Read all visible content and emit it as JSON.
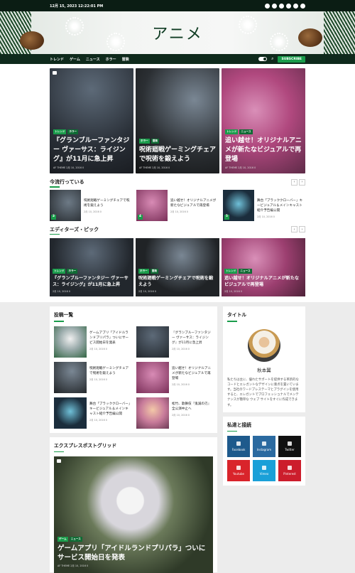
{
  "topbar": {
    "datetime": "12月 15, 2023 12:22:01 PM",
    "social_icons": [
      "facebook-icon",
      "instagram-icon",
      "twitter-icon",
      "youtube-icon",
      "vimeo-icon",
      "pinterest-icon"
    ]
  },
  "site": {
    "logo": "アニメ"
  },
  "nav": {
    "items": [
      "トレンド",
      "ゲーム",
      "ニュース",
      "ホラー",
      "冒険"
    ],
    "subscribe": "SUBSCRIBE"
  },
  "featured": [
    {
      "tags": [
        "トレンド",
        "ホラー"
      ],
      "title": "『グランブルーファンタジー ヴァーサス：ライジング』が11月に急上昇",
      "meta": "AF THEME  2月 10, 2016  0"
    },
    {
      "tags": [
        "ホラー",
        "冒険"
      ],
      "title": "呪術廻戦ゲーミングチェアで呪術を鍛えよう",
      "meta": "AF THEME  2月 10, 2016  0"
    },
    {
      "tags": [
        "トレンド",
        "ニュース"
      ],
      "title": "追い越せ！オリジナルアニメが新たなビジュアルで再登場",
      "meta": "AF THEME  2月 10, 2016  0"
    }
  ],
  "trending": {
    "heading": "今流行っている",
    "items": [
      {
        "num": "3",
        "title": "呪術廻戦ゲーミングチェアで呪術を鍛えよう",
        "meta": "2月 10, 2016  0"
      },
      {
        "num": "4",
        "title": "追い越せ！オリジナルアニメが新たなビジュアルで再登場",
        "meta": "2月 10, 2016  0"
      },
      {
        "num": "5",
        "title": "舞台「ブラッククローバー」キービジュアル＆メインキャスト紹介予告編公開",
        "meta": "2月 10, 2016  0"
      }
    ]
  },
  "editors": {
    "heading": "エディターズ・ピック",
    "items": [
      {
        "tags": [
          "トレンド",
          "ホラー"
        ],
        "title": "『グランブルーファンタジー ヴァーサス：ライジング』が11月に急上昇",
        "meta": "2月 10, 2016  0"
      },
      {
        "tags": [
          "ホラー",
          "冒険"
        ],
        "title": "呪術廻戦ゲーミングチェアで呪術を鍛えよう",
        "meta": "2月 10, 2016  0"
      },
      {
        "tags": [
          "トレンド",
          "ニュース"
        ],
        "title": "追い越せ！オリジナルアニメが新たなビジュアルで再登場",
        "meta": "2月 10, 2016  0"
      }
    ]
  },
  "posts": {
    "heading": "投稿一覧",
    "items": [
      {
        "title": "ゲームアプリ「アイドルランドプリパラ」ついにサービス開始日を発表",
        "meta": "2月 10, 2016  0"
      },
      {
        "title": "『グランブルーファンタジー ヴァーサス：ライジング』が11月に急上昇",
        "meta": "2月 10, 2016  0"
      },
      {
        "title": "呪術廻戦ゲーミングチェアで呪術を鍛えよう",
        "meta": "2月 10, 2016  0"
      },
      {
        "title": "追い越せ！オリジナルアニメが新たなビジュアルで再登場",
        "meta": "2月 10, 2016  0"
      },
      {
        "title": "舞台「ブラッククローバー」キービジュアル＆メインキャスト紹介予告編公開",
        "meta": "2月 10, 2016  0"
      },
      {
        "title": "松竹、歌舞伎『鬼滅の刃』全公演中止へ",
        "meta": "2月 10, 2016  0"
      }
    ]
  },
  "sidebar": {
    "title_heading": "タイトル",
    "author_name": "秋本翼",
    "author_desc": "私たちは主に、優れたサポートを提供する革新的なコードとエレガントなデザインに重点を置いています。当社のワードプレステーマとプラグインを使用すると、エレガントでプロフェッショナルでメンテナンスが簡単な ウェブ サイトをすぐに作成できます。",
    "connect_heading": "私達と接続",
    "social": [
      {
        "label": "Facebook",
        "color": "#1e5a8c",
        "icon": "facebook-icon"
      },
      {
        "label": "Instagram",
        "color": "#2b6aa0",
        "icon": "instagram-icon"
      },
      {
        "label": "Twitter",
        "color": "#111111",
        "icon": "twitter-icon"
      },
      {
        "label": "Youtube",
        "color": "#d9242b",
        "icon": "youtube-icon"
      },
      {
        "label": "Vimeo",
        "color": "#1aa0d8",
        "icon": "vimeo-icon"
      },
      {
        "label": "Pinterest",
        "color": "#cc1d2c",
        "icon": "pinterest-icon"
      }
    ]
  },
  "express": {
    "heading": "エクスプレスポストグリッド",
    "tags": [
      "ゲーム",
      "ニュース"
    ],
    "title": "ゲームアプリ「アイドルランドプリパラ」ついにサービス開始日を発表",
    "meta": "AF THEME  2月 10, 2016  0"
  }
}
